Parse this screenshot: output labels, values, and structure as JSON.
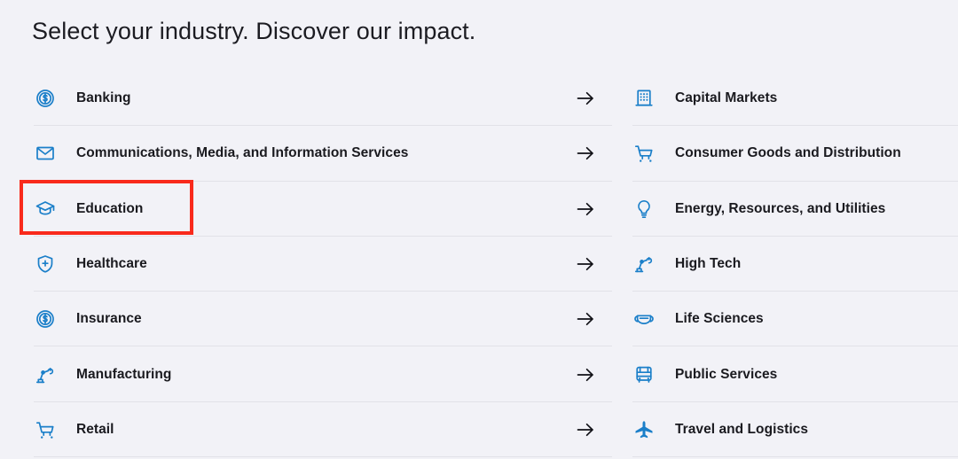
{
  "page": {
    "title": "Select your industry. Discover our impact.",
    "background_color": "#f2f2f7",
    "icon_color": "#1b7fc9",
    "text_color": "#1a1a1f",
    "divider_color": "#e2e2e8",
    "highlight_color": "#f92a1c"
  },
  "industries": {
    "left_column": [
      {
        "label": "Banking",
        "icon": "dollar-circle-icon",
        "arrow": "arrow-right-icon"
      },
      {
        "label": "Communications, Media, and Information Services",
        "icon": "envelope-icon",
        "arrow": "arrow-right-icon"
      },
      {
        "label": "Education",
        "icon": "graduation-cap-icon",
        "arrow": "arrow-right-icon"
      },
      {
        "label": "Healthcare",
        "icon": "shield-plus-icon",
        "arrow": "arrow-right-icon"
      },
      {
        "label": "Insurance",
        "icon": "dollar-circle-icon",
        "arrow": "arrow-right-icon"
      },
      {
        "label": "Manufacturing",
        "icon": "robot-arm-icon",
        "arrow": "arrow-right-icon"
      },
      {
        "label": "Retail",
        "icon": "shopping-cart-icon",
        "arrow": "arrow-right-icon"
      }
    ],
    "right_column": [
      {
        "label": "Capital Markets",
        "icon": "office-building-icon"
      },
      {
        "label": "Consumer Goods and Distribution",
        "icon": "shopping-cart-icon"
      },
      {
        "label": "Energy, Resources, and Utilities",
        "icon": "lightbulb-icon"
      },
      {
        "label": "High Tech",
        "icon": "robot-arm-icon"
      },
      {
        "label": "Life Sciences",
        "icon": "face-mask-icon"
      },
      {
        "label": "Public Services",
        "icon": "bus-icon"
      },
      {
        "label": "Travel and Logistics",
        "icon": "airplane-icon"
      }
    ]
  },
  "annotation": {
    "target": "Education",
    "shape": "rectangle",
    "color": "#f92a1c"
  }
}
